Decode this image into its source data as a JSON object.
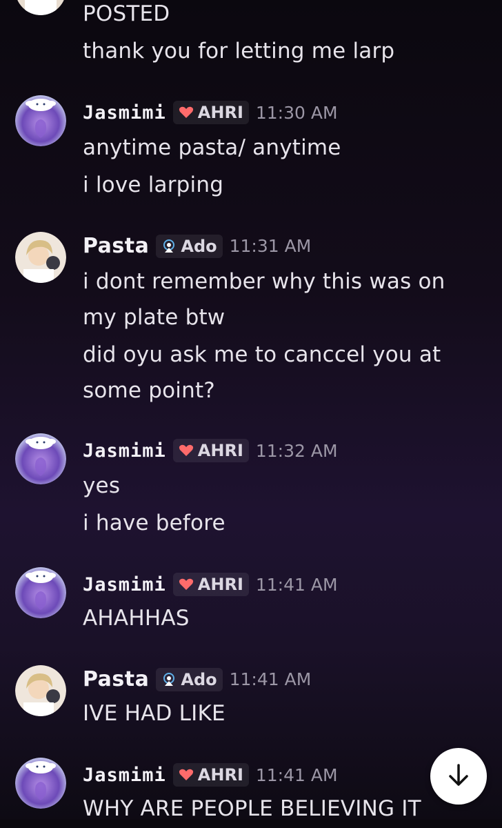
{
  "messages": [
    {
      "id": "m0",
      "continuation": true,
      "lines": [
        "POSTED",
        "thank you for letting me larp"
      ]
    },
    {
      "id": "m1",
      "author": "Jasmimi",
      "role": "AHRI",
      "role_icon": "heart-icon",
      "time": "11:30 AM",
      "lines": [
        "anytime pasta/ anytime",
        "i love larping"
      ]
    },
    {
      "id": "m2",
      "author": "Pasta",
      "role": "Ado",
      "role_icon": "ado-icon",
      "time": "11:31 AM",
      "lines": [
        "i dont remember why this was on",
        "my plate btw",
        "did oyu ask me to canccel you at",
        "some point?"
      ]
    },
    {
      "id": "m3",
      "author": "Jasmimi",
      "role": "AHRI",
      "role_icon": "heart-icon",
      "time": "11:32 AM",
      "lines": [
        "yes",
        "i have before"
      ]
    },
    {
      "id": "m4",
      "author": "Jasmimi",
      "role": "AHRI",
      "role_icon": "heart-icon",
      "time": "11:41 AM",
      "lines": [
        "AHAHHAS"
      ]
    },
    {
      "id": "m5",
      "author": "Pasta",
      "role": "Ado",
      "role_icon": "ado-icon",
      "time": "11:41 AM",
      "lines": [
        "IVE HAD LIKE"
      ]
    },
    {
      "id": "m6",
      "author": "Jasmimi",
      "role": "AHRI",
      "role_icon": "heart-icon",
      "time": "11:41 AM",
      "lines": [
        "WHY ARE PEOPLE BELIEVING IT"
      ]
    }
  ],
  "colors": {
    "background_top": "#0b080f",
    "background_mid": "#1e1230",
    "heart": "#ff6b6b",
    "ado_icon": "#5fb0e8",
    "timestamp": "#9c97a6"
  },
  "jump_button": {
    "icon": "arrow-down-icon"
  }
}
